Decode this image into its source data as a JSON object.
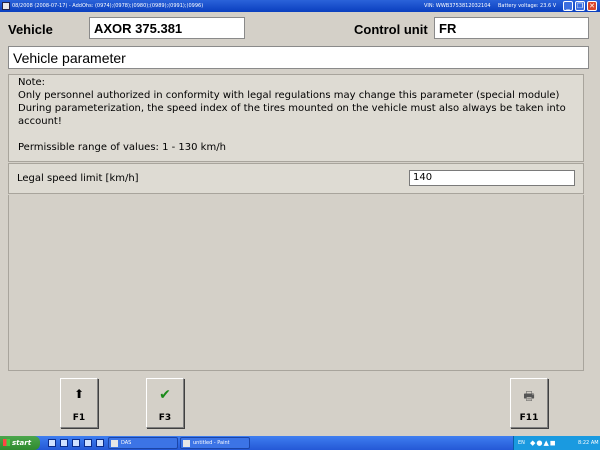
{
  "titlebar": {
    "text": "08/2008 (2008-07-17) - AddOhs: (0974);(0978);(0980);(0989);(0991);(0996)",
    "vin": "VIN: WWB3753812032104",
    "battery": "Battery voltage: 23.6 V",
    "minimize_glyph": "_",
    "restore_glyph": "❐",
    "close_glyph": "✕"
  },
  "header": {
    "vehicle_label": "Vehicle",
    "vehicle_value": "AXOR 375.381",
    "control_unit_label": "Control unit",
    "control_unit_value": "FR"
  },
  "parameter_title": "Vehicle parameter",
  "note": {
    "lines": [
      "Note:",
      "Only personnel authorized in conformity with legal regulations may change this parameter (special module)",
      "During parameterization, the speed index of the tires mounted on the vehicle must also always be taken into",
      "account!",
      "",
      "Permissible range of values: 1 - 130 km/h"
    ]
  },
  "parameter": {
    "label": "Legal speed limit [km/h]",
    "value": "140"
  },
  "function_keys": {
    "f1": {
      "label": "F1",
      "icon": "up-arrow-icon",
      "glyph": "⬆"
    },
    "f3": {
      "label": "F3",
      "icon": "check-icon",
      "glyph": "✔",
      "color": "#1a8a1a"
    },
    "f11": {
      "label": "F11",
      "icon": "printer-icon",
      "glyph": "🖶"
    }
  },
  "taskbar": {
    "start_label": "start",
    "tasks": [
      "DAS",
      "untitled - Paint"
    ],
    "language": "EN",
    "clock": "8:22 AM"
  },
  "colors": {
    "titlebar": "#0a3fbf",
    "taskbar": "#2458d6",
    "window_bg": "#d4d0c8",
    "accept_green": "#1a8a1a"
  }
}
